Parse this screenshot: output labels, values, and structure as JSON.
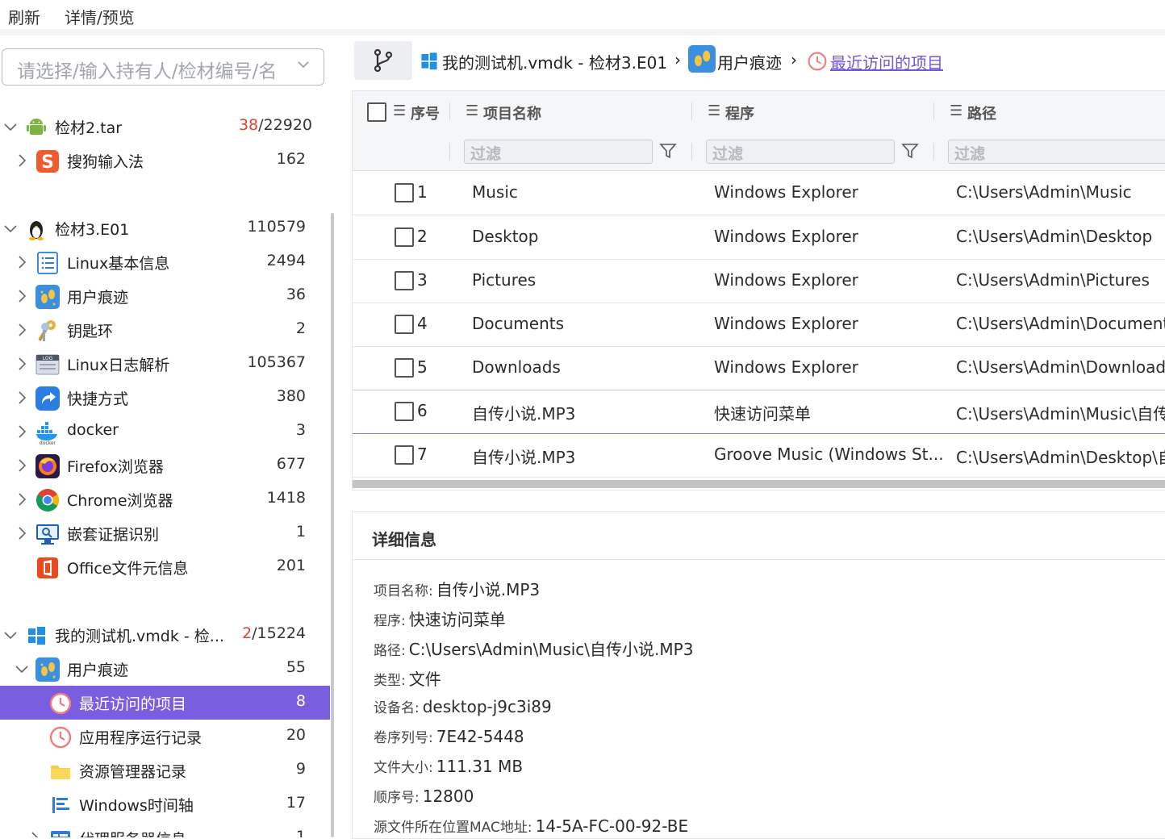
{
  "menu": {
    "refresh": "刷新",
    "detail_preview": "详情/预览"
  },
  "selector": {
    "placeholder": "请选择/输入持有人/检材编号/名"
  },
  "tree": {
    "n1": {
      "label": "检材2.tar",
      "count_red": "38",
      "count_rest": "/22920"
    },
    "n1a": {
      "label": "搜狗输入法",
      "count": "162"
    },
    "n2": {
      "label": "检材3.E01",
      "count": "110579"
    },
    "n2a": {
      "label": "Linux基本信息",
      "count": "2494"
    },
    "n2b": {
      "label": "用户痕迹",
      "count": "36"
    },
    "n2c": {
      "label": "钥匙环",
      "count": "2"
    },
    "n2d": {
      "label": "Linux日志解析",
      "count": "105367"
    },
    "n2e": {
      "label": "快捷方式",
      "count": "380"
    },
    "n2f": {
      "label": "docker",
      "count": "3"
    },
    "n2g": {
      "label": "Firefox浏览器",
      "count": "677"
    },
    "n2h": {
      "label": "Chrome浏览器",
      "count": "1418"
    },
    "n2i": {
      "label": "嵌套证据识别",
      "count": "1"
    },
    "n2j": {
      "label": "Office文件元信息",
      "count": "201"
    },
    "n3": {
      "label": "我的测试机.vmdk - 检...",
      "count_red": "2",
      "count_rest": "/15224"
    },
    "n3a": {
      "label": "用户痕迹",
      "count": "55"
    },
    "n3a1": {
      "label": "最近访问的项目",
      "count": "8"
    },
    "n3a2": {
      "label": "应用程序运行记录",
      "count": "20"
    },
    "n3a3": {
      "label": "资源管理器记录",
      "count": "9"
    },
    "n3a4": {
      "label": "Windows时间轴",
      "count": "17"
    },
    "n3b": {
      "label": "代理服务器信息",
      "count": "1"
    }
  },
  "breadcrumb": {
    "c1": "我的测试机.vmdk - 检材3.E01",
    "c2": "用户痕迹",
    "c3": "最近访问的项目"
  },
  "table": {
    "headers": {
      "seq": "序号",
      "name": "项目名称",
      "program": "程序",
      "path": "路径"
    },
    "filter_placeholder": "过滤",
    "rows": [
      {
        "seq": "1",
        "name": "Music",
        "program": "Windows Explorer",
        "path": "C:\\Users\\Admin\\Music"
      },
      {
        "seq": "2",
        "name": "Desktop",
        "program": "Windows Explorer",
        "path": "C:\\Users\\Admin\\Desktop"
      },
      {
        "seq": "3",
        "name": "Pictures",
        "program": "Windows Explorer",
        "path": "C:\\Users\\Admin\\Pictures"
      },
      {
        "seq": "4",
        "name": "Documents",
        "program": "Windows Explorer",
        "path": "C:\\Users\\Admin\\Documents"
      },
      {
        "seq": "5",
        "name": "Downloads",
        "program": "Windows Explorer",
        "path": "C:\\Users\\Admin\\Downloads"
      },
      {
        "seq": "6",
        "name": "自传小说.MP3",
        "program": "快速访问菜单",
        "path": "C:\\Users\\Admin\\Music\\自传"
      },
      {
        "seq": "7",
        "name": "自传小说.MP3",
        "program": "Groove Music (Windows St...",
        "path": "C:\\Users\\Admin\\Desktop\\自"
      }
    ]
  },
  "detail": {
    "title": "详细信息",
    "fields": [
      {
        "label": "项目名称:",
        "value": "自传小说.MP3"
      },
      {
        "label": "程序:",
        "value": "快速访问菜单"
      },
      {
        "label": "路径:",
        "value": "C:\\Users\\Admin\\Music\\自传小说.MP3"
      },
      {
        "label": "类型:",
        "value": "文件"
      },
      {
        "label": "设备名:",
        "value": "desktop-j9c3i89"
      },
      {
        "label": "卷序列号:",
        "value": "7E42-5448"
      },
      {
        "label": "文件大小:",
        "value": "111.31 MB"
      },
      {
        "label": "顺序号:",
        "value": "12800"
      },
      {
        "label": "源文件所在位置MAC地址:",
        "value": "14-5A-FC-00-92-BE"
      }
    ]
  },
  "colors": {
    "accent": "#7b5de0",
    "link": "#7257d8",
    "count_red": "#e0403a"
  }
}
